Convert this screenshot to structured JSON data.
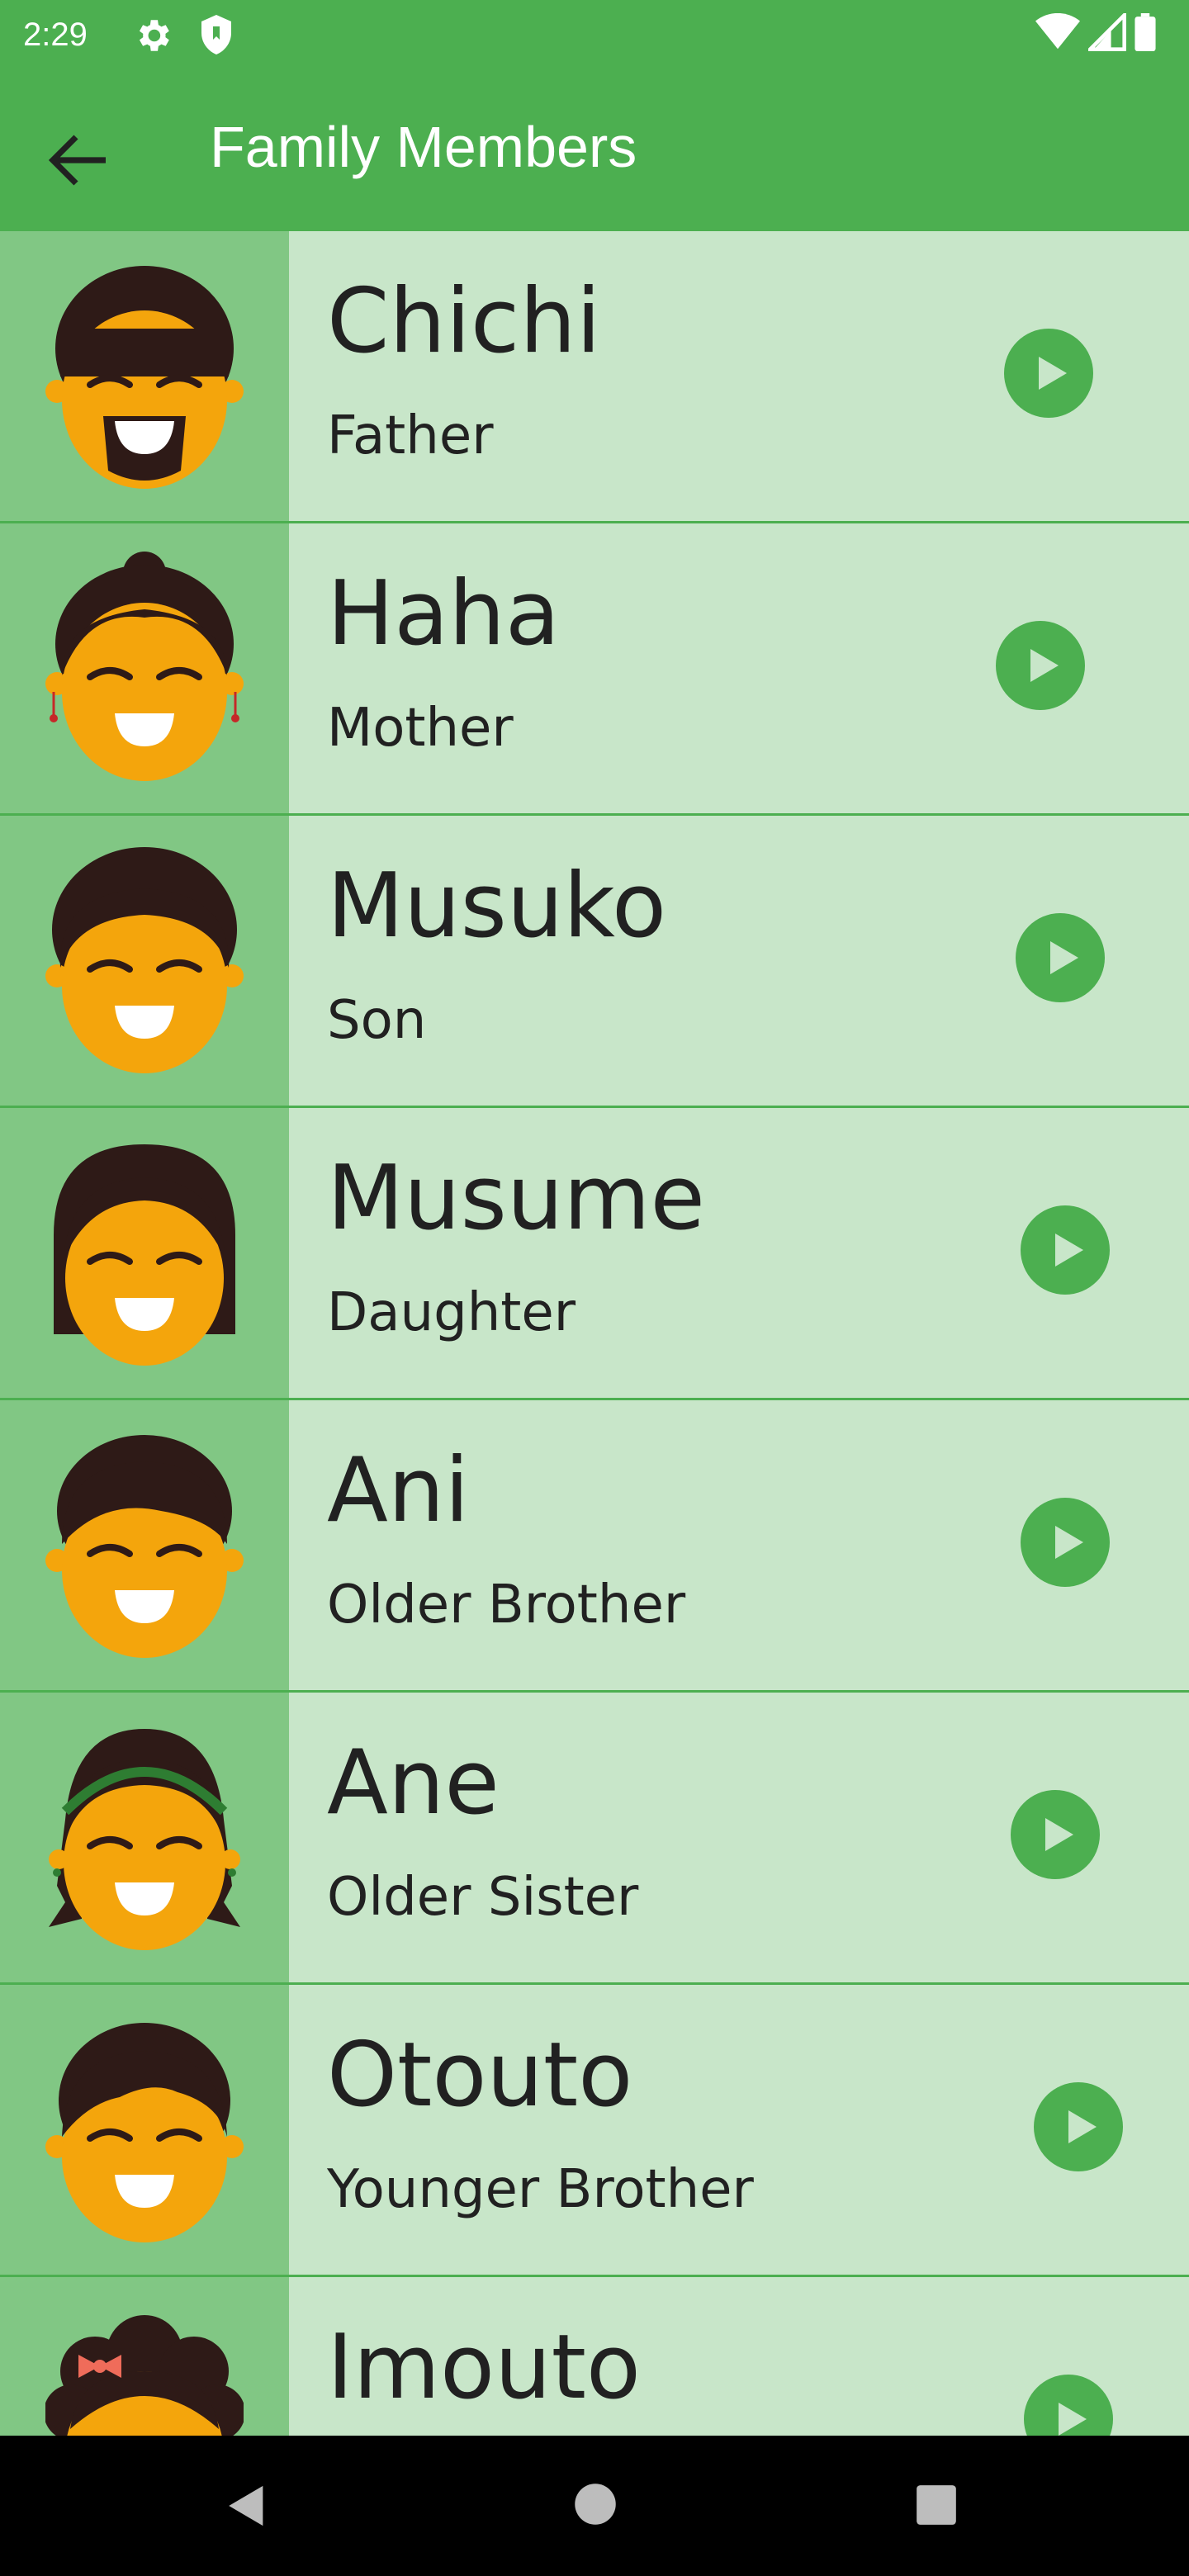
{
  "status_bar": {
    "time": "2:29",
    "icons": [
      "gear-icon",
      "shield-icon",
      "wifi-icon",
      "signal-icon",
      "battery-icon"
    ]
  },
  "app_bar": {
    "title": "Family Members",
    "back_icon": "arrow-left-icon"
  },
  "members": [
    {
      "name": "Chichi",
      "role": "Father",
      "avatar": "father-avatar-icon"
    },
    {
      "name": "Haha",
      "role": "Mother",
      "avatar": "mother-avatar-icon"
    },
    {
      "name": "Musuko",
      "role": "Son",
      "avatar": "son-avatar-icon"
    },
    {
      "name": "Musume",
      "role": "Daughter",
      "avatar": "daughter-avatar-icon"
    },
    {
      "name": "Ani",
      "role": "Older Brother",
      "avatar": "older-brother-avatar-icon"
    },
    {
      "name": "Ane",
      "role": "Older Sister",
      "avatar": "older-sister-avatar-icon"
    },
    {
      "name": "Otouto",
      "role": "Younger Brother",
      "avatar": "younger-brother-avatar-icon"
    },
    {
      "name": "Imouto",
      "role": "",
      "avatar": "younger-sister-avatar-icon"
    }
  ],
  "nav_bar": {
    "icons": [
      "nav-back-icon",
      "nav-home-icon",
      "nav-recents-icon"
    ]
  },
  "colors": {
    "primary": "#4CAF50",
    "row_background": "#C8E6C9",
    "avatar_panel": "#81C784",
    "face": "#F4A50C",
    "hair": "#2E1A17",
    "text": "#212121"
  }
}
